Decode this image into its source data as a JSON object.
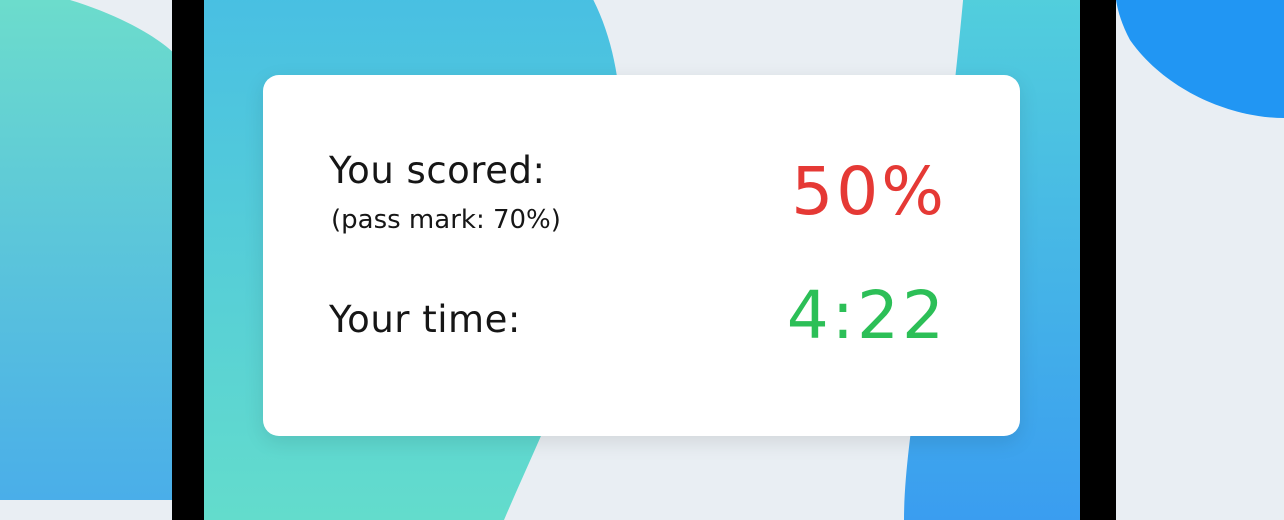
{
  "result": {
    "score_label": "You scored:",
    "pass_mark_label": "(pass mark: 70%)",
    "score_value": "50%",
    "time_label": "Your time:",
    "time_value": "4:22"
  },
  "colors": {
    "score": "#e53935",
    "time": "#2cbf57",
    "background": "#e9eef3",
    "teal": "#64dccc",
    "blue": "#4aaee9",
    "bright_blue": "#2196f3",
    "device_frame": "#000000"
  }
}
